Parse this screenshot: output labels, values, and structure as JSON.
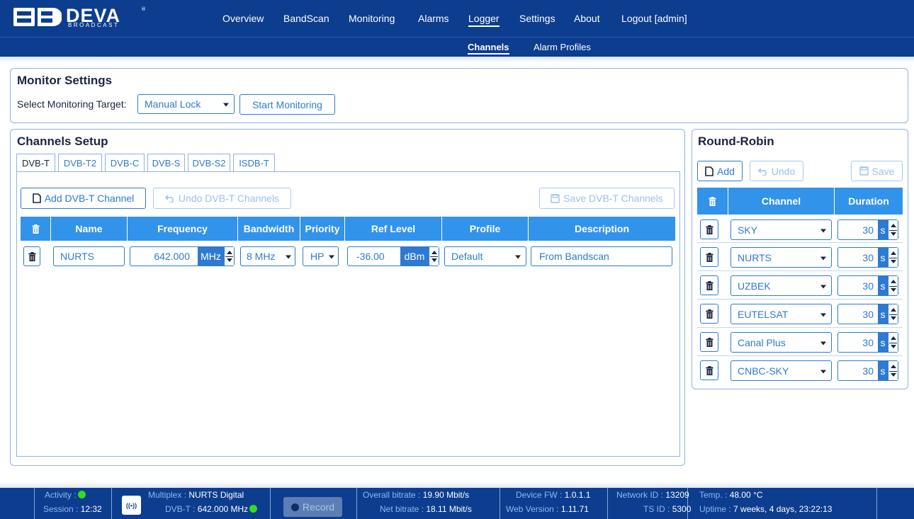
{
  "brand": {
    "word": "DEVA",
    "sub": "BROADCAST",
    "reg": "®"
  },
  "nav": {
    "items": [
      "Overview",
      "BandScan",
      "Monitoring",
      "Alarms",
      "Logger",
      "Settings",
      "About",
      "Logout [admin]"
    ],
    "active": "Logger"
  },
  "subnav": {
    "items": [
      "Channels",
      "Alarm Profiles"
    ],
    "active": "Channels"
  },
  "monitor": {
    "title": "Monitor Settings",
    "target_label": "Select Monitoring Target:",
    "target_value": "Manual Lock",
    "start_button": "Start Monitoring"
  },
  "channels": {
    "title": "Channels Setup",
    "tabs": [
      "DVB-T",
      "DVB-T2",
      "DVB-C",
      "DVB-S",
      "DVB-S2",
      "ISDB-T"
    ],
    "active_tab": "DVB-T",
    "add_button": "Add DVB-T Channel",
    "undo_button": "Undo DVB-T Channels",
    "save_button": "Save DVB-T Channels",
    "columns": [
      "Name",
      "Frequency",
      "Bandwidth",
      "Priority",
      "Ref Level",
      "Profile",
      "Description"
    ],
    "rows": [
      {
        "name": "NURTS",
        "frequency": "642.000",
        "freq_unit": "MHz",
        "bandwidth": "8 MHz",
        "priority": "HP",
        "ref_level": "-36.00",
        "ref_unit": "dBm",
        "profile": "Default",
        "description": "From Bandscan"
      }
    ]
  },
  "roundrobin": {
    "title": "Round-Robin",
    "add_button": "Add",
    "undo_button": "Undo",
    "save_button": "Save",
    "columns": [
      "Channel",
      "Duration"
    ],
    "rows": [
      {
        "channel": "SKY",
        "duration": "30",
        "unit": "s"
      },
      {
        "channel": "NURTS",
        "duration": "30",
        "unit": "s"
      },
      {
        "channel": "UZBEK",
        "duration": "30",
        "unit": "s"
      },
      {
        "channel": "EUTELSAT",
        "duration": "30",
        "unit": "s"
      },
      {
        "channel": "Canal Plus",
        "duration": "30",
        "unit": "s"
      },
      {
        "channel": "CNBC-SKY",
        "duration": "30",
        "unit": "s"
      }
    ]
  },
  "status": {
    "activity_label": "Activity :",
    "session_label": "Session :",
    "session_value": "12:32",
    "multiplex_label": "Multiplex :",
    "multiplex_value": "NURTS Digital",
    "dvbt_label": "DVB-T :",
    "dvbt_value": "642.000 MHz",
    "record_button": "Record",
    "overall_label": "Overall bitrate :",
    "overall_value": "19.90 Mbit/s",
    "net_label": "Net bitrate :",
    "net_value": "18.11 Mbit/s",
    "fw_label": "Device FW :",
    "fw_value": "1.0.1.1",
    "web_label": "Web Version :",
    "web_value": "1.11.71",
    "netid_label": "Network ID :",
    "netid_value": "13209",
    "tsid_label": "TS ID :",
    "tsid_value": "5300",
    "temp_label": "Temp. :",
    "temp_value": "48.00 °C",
    "uptime_label": "Uptime :",
    "uptime_value": "7 weeks, 4 days, 23:22:13"
  },
  "colors": {
    "navy": "#0c3d8f",
    "accent": "#2e7ad1",
    "header": "#3293ea",
    "ok": "#33dd22"
  }
}
